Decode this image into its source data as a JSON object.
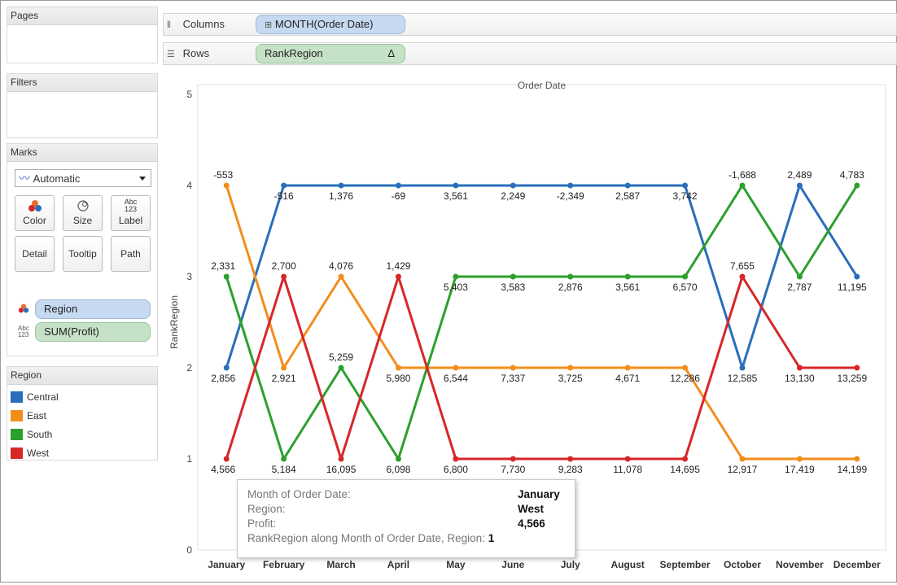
{
  "panels": {
    "pages": "Pages",
    "filters": "Filters",
    "marks": "Marks",
    "marks_type": "Automatic",
    "mark_buttons": [
      "Color",
      "Size",
      "Label",
      "Detail",
      "Tooltip",
      "Path"
    ],
    "size_icon_text": "Abc 123",
    "region_pill": "Region",
    "profit_pill": "SUM(Profit)",
    "legend_title": "Region",
    "legend": [
      {
        "label": "Central",
        "color": "#2a6ebb"
      },
      {
        "label": "East",
        "color": "#f28e1c"
      },
      {
        "label": "South",
        "color": "#2ca02c"
      },
      {
        "label": "West",
        "color": "#d62728"
      }
    ]
  },
  "shelves": {
    "columns_label": "Columns",
    "columns_pill": "MONTH(Order Date)",
    "rows_label": "Rows",
    "rows_pill": "RankRegion",
    "rows_pill_icon": "Δ"
  },
  "chart_data": {
    "type": "line",
    "title": "Order Date",
    "ylabel": "RankRegion",
    "xlabel": "",
    "ylim": [
      0,
      5
    ],
    "yticks": [
      0,
      1,
      2,
      3,
      4,
      5
    ],
    "categories": [
      "January",
      "February",
      "March",
      "April",
      "May",
      "June",
      "July",
      "August",
      "September",
      "October",
      "November",
      "December"
    ],
    "series": [
      {
        "name": "Central",
        "color": "#2a6ebb",
        "values": [
          2,
          4,
          4,
          4,
          4,
          4,
          4,
          4,
          4,
          2,
          4,
          3
        ],
        "labels": [
          "2,856",
          "-516",
          "1,376",
          "-69",
          "3,561",
          "2,249",
          "-2,349",
          "2,587",
          "3,742",
          "12,585",
          "2,489",
          "11,195"
        ]
      },
      {
        "name": "East",
        "color": "#f28e1c",
        "values": [
          4,
          2,
          3,
          2,
          2,
          2,
          2,
          2,
          2,
          1,
          1,
          1
        ],
        "labels": [
          "-553",
          "2,921",
          "4,076",
          "5,980",
          "6,544",
          "7,337",
          "3,725",
          "4,671",
          "12,286",
          "12,917",
          "17,419",
          "14,199"
        ]
      },
      {
        "name": "South",
        "color": "#2ca02c",
        "values": [
          3,
          1,
          2,
          1,
          3,
          3,
          3,
          3,
          3,
          4,
          3,
          4
        ],
        "labels": [
          "2,331",
          "5,184",
          "5,259",
          "6,098",
          "5,403",
          "3,583",
          "2,876",
          "3,561",
          "6,570",
          "-1,688",
          "2,787",
          "4,783"
        ]
      },
      {
        "name": "West",
        "color": "#d62728",
        "values": [
          1,
          3,
          1,
          3,
          1,
          1,
          1,
          1,
          1,
          3,
          2,
          2
        ],
        "labels": [
          "4,566",
          "2,700",
          "16,095",
          "1,429",
          "6,800",
          "7,730",
          "9,283",
          "11,078",
          "14,695",
          "7,655",
          "13,130",
          "13,259"
        ]
      }
    ]
  },
  "tooltip": {
    "rows": [
      {
        "key": "Month of Order Date:",
        "value": "January"
      },
      {
        "key": "Region:",
        "value": "West"
      },
      {
        "key": "Profit:",
        "value": "4,566"
      },
      {
        "key": "RankRegion along Month of Order Date, Region:",
        "value": "1"
      }
    ]
  }
}
